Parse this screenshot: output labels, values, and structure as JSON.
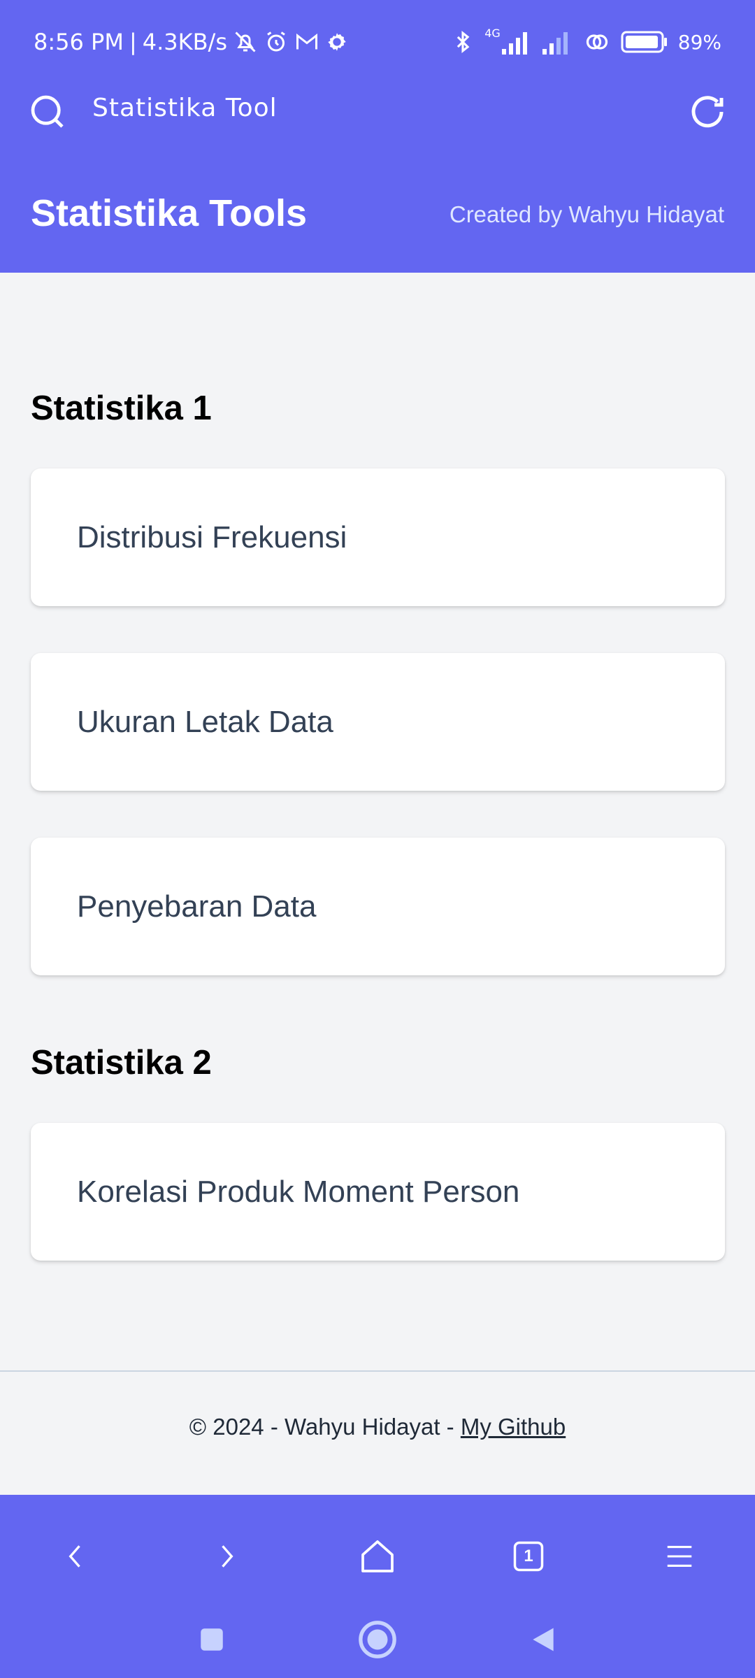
{
  "status_bar": {
    "time": "8:56 PM",
    "net_speed": "4.3KB/s",
    "network_type": "4G",
    "battery": "89%"
  },
  "browser": {
    "title": "Statistika Tool",
    "search_icon": "search-icon",
    "refresh_icon": "refresh-icon"
  },
  "header": {
    "title": "Statistika Tools",
    "author": "Created by Wahyu Hidayat"
  },
  "sections": [
    {
      "title": "Statistika 1",
      "items": [
        {
          "label": "Distribusi Frekuensi"
        },
        {
          "label": "Ukuran Letak Data"
        },
        {
          "label": "Penyebaran Data"
        }
      ]
    },
    {
      "title": "Statistika 2",
      "items": [
        {
          "label": "Korelasi Produk Moment Person"
        }
      ]
    }
  ],
  "footer": {
    "text": "© 2024 - Wahyu Hidayat - ",
    "link": "My Github"
  },
  "browser_nav": {
    "tab_count": "1"
  },
  "colors": {
    "primary": "#6366f1",
    "background": "#f3f4f6",
    "card": "#ffffff",
    "text": "#334155"
  }
}
